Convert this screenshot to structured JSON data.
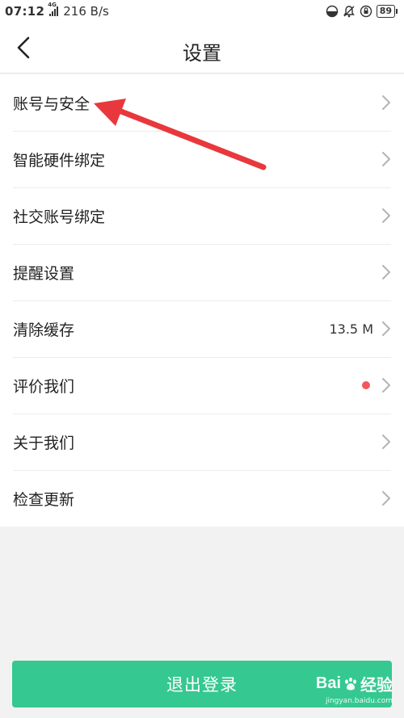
{
  "status_bar": {
    "time": "07:12",
    "network_type": "4G",
    "speed": "216 B/s",
    "battery": "89",
    "icons": [
      "eye-comfort-icon",
      "mute-bell-icon",
      "rotation-lock-icon",
      "battery-icon"
    ]
  },
  "header": {
    "title": "设置",
    "back_icon": "chevron-left-icon"
  },
  "settings": {
    "items": [
      {
        "label": "账号与安全"
      },
      {
        "label": "智能硬件绑定"
      },
      {
        "label": "社交账号绑定"
      },
      {
        "label": "提醒设置"
      },
      {
        "label": "清除缓存",
        "value": "13.5 M"
      },
      {
        "label": "评价我们",
        "badge": "red-dot"
      },
      {
        "label": "关于我们"
      },
      {
        "label": "检查更新"
      }
    ]
  },
  "logout": {
    "label": "退出登录"
  },
  "watermark": {
    "brand": "Bai",
    "brand_suffix": "经验",
    "url": "jingyan.baidu.com"
  },
  "colors": {
    "accent": "#35c891",
    "annotation_arrow": "#e8383d",
    "badge": "#f2575b"
  }
}
